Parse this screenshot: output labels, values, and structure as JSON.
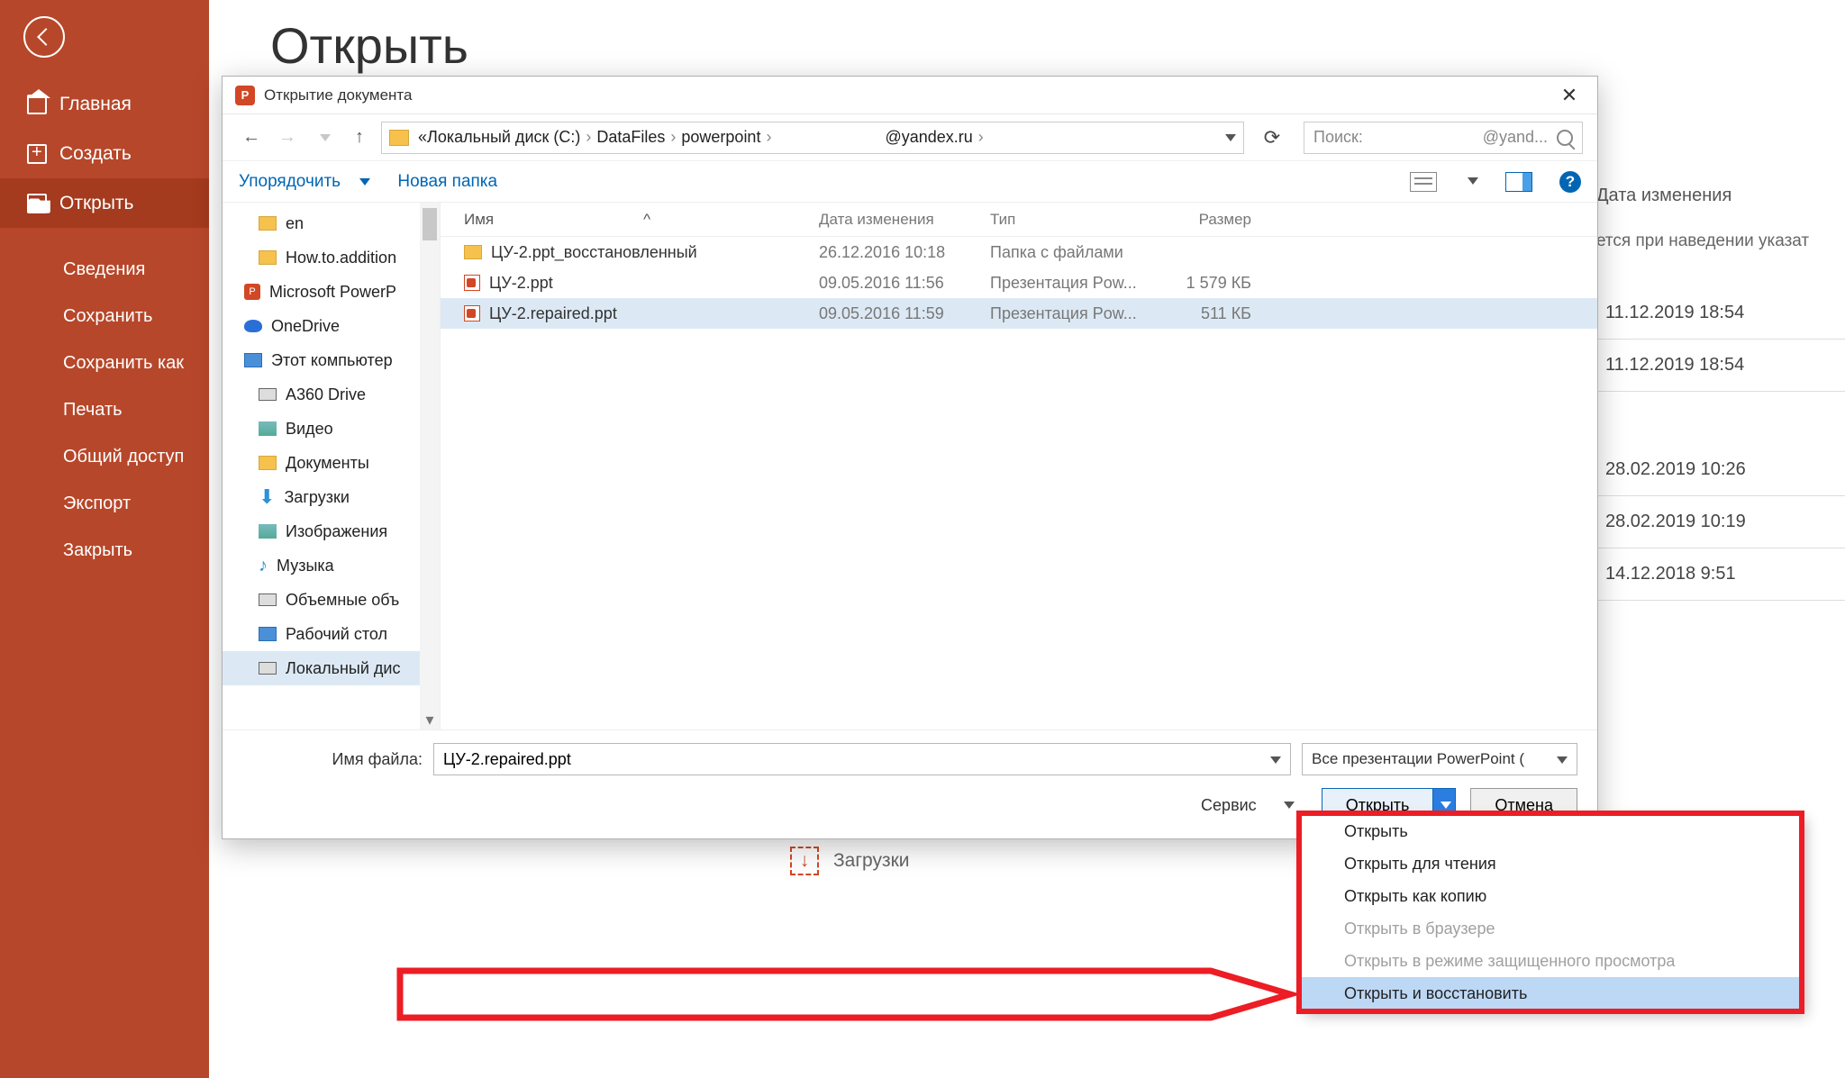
{
  "page": {
    "title": "Открыть"
  },
  "sidebar": {
    "back": "back",
    "items": [
      {
        "icon": "home-icon",
        "label": "Главная"
      },
      {
        "icon": "new-icon",
        "label": "Создать"
      },
      {
        "icon": "open-icon",
        "label": "Открыть",
        "active": true
      }
    ],
    "sub_items": [
      {
        "label": "Сведения"
      },
      {
        "label": "Сохранить"
      },
      {
        "label": "Сохранить как"
      },
      {
        "label": "Печать"
      },
      {
        "label": "Общий доступ"
      },
      {
        "label": "Экспорт"
      },
      {
        "label": "Закрыть"
      }
    ]
  },
  "rightcol": {
    "header": "Дата изменения",
    "pin_hint": "ется при наведении указат",
    "rows": [
      "11.12.2019 18:54",
      "11.12.2019 18:54",
      "",
      "28.02.2019 10:26",
      "28.02.2019 10:19",
      "14.12.2018 9:51"
    ]
  },
  "dialog": {
    "title": "Открытие документа",
    "navbar": {
      "crumbs": [
        "«",
        "Локальный диск (C:)",
        "DataFiles",
        "powerpoint",
        "",
        "@yandex.ru",
        ""
      ],
      "search_prefix": "Поиск:",
      "search_hint": "@yand..."
    },
    "cmd": {
      "organize": "Упорядочить",
      "newfolder": "Новая папка"
    },
    "tree": [
      {
        "icon": "folder",
        "label": "en",
        "indent": true
      },
      {
        "icon": "folder",
        "label": "How.to.addition",
        "indent": true
      },
      {
        "icon": "pp",
        "label": "Microsoft PowerP"
      },
      {
        "icon": "cloud",
        "label": "OneDrive"
      },
      {
        "icon": "pc",
        "label": "Этот компьютер"
      },
      {
        "icon": "drive",
        "label": "A360 Drive",
        "indent": true
      },
      {
        "icon": "img",
        "label": "Видео",
        "indent": true
      },
      {
        "icon": "folder",
        "label": "Документы",
        "indent": true
      },
      {
        "icon": "down",
        "label": "Загрузки",
        "indent": true
      },
      {
        "icon": "img",
        "label": "Изображения",
        "indent": true
      },
      {
        "icon": "music",
        "label": "Музыка",
        "indent": true
      },
      {
        "icon": "drive",
        "label": "Объемные объ",
        "indent": true
      },
      {
        "icon": "pc",
        "label": "Рабочий стол",
        "indent": true
      },
      {
        "icon": "drive",
        "label": "Локальный дис",
        "indent": true,
        "selected": true
      }
    ],
    "columns": {
      "name": "Имя",
      "date": "Дата изменения",
      "type": "Тип",
      "size": "Размер"
    },
    "files": [
      {
        "icon": "folder",
        "name": "ЦУ-2.ppt_восстановленный",
        "date": "26.12.2016 10:18",
        "type": "Папка с файлами",
        "size": ""
      },
      {
        "icon": "ppt",
        "name": "ЦУ-2.ppt",
        "date": "09.05.2016 11:56",
        "type": "Презентация Pow...",
        "size": "1 579 КБ"
      },
      {
        "icon": "ppt",
        "name": "ЦУ-2.repaired.ppt",
        "date": "09.05.2016 11:59",
        "type": "Презентация Pow...",
        "size": "511 КБ",
        "selected": true
      }
    ],
    "footer": {
      "fname_label": "Имя файла:",
      "fname_value": "ЦУ-2.repaired.ppt",
      "filter": "Все презентации PowerPoint (",
      "tools": "Сервис",
      "open": "Открыть",
      "cancel": "Отмена"
    }
  },
  "menu": {
    "items": [
      {
        "label": "Открыть"
      },
      {
        "label": "Открыть для чтения"
      },
      {
        "label": "Открыть как копию"
      },
      {
        "label": "Открыть в браузере",
        "disabled": true
      },
      {
        "label": "Открыть в режиме защищенного просмотра",
        "disabled": true
      },
      {
        "label": "Открыть и восстановить",
        "hovered": true
      }
    ]
  },
  "downloads_bg": {
    "label": "Загрузки"
  }
}
